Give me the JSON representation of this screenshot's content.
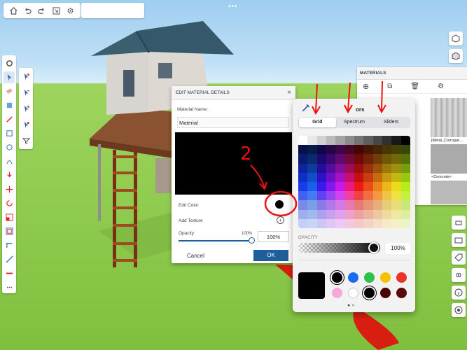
{
  "toolbar": {
    "buttons": [
      "home-icon",
      "undo-icon",
      "redo-icon",
      "export-icon",
      "settings-icon"
    ],
    "more": "•••"
  },
  "materials_panel": {
    "title": "MATERIALS",
    "items": [
      "[Metal_Corrogat...",
      "<Concrete>"
    ]
  },
  "edit_dialog": {
    "title": "EDIT MATERIAL DETAILS",
    "name_label": "Material Name:",
    "name_value": "Material",
    "edit_color_label": "Edit Color",
    "add_texture_label": "Add Texture",
    "opacity_label": "Opacity",
    "opacity_percent": "100%",
    "opacity_value": "100%",
    "opacity_level": 1.0,
    "cancel_label": "Cancel",
    "ok_label": "OK"
  },
  "color_picker": {
    "title_partial": "ors",
    "tabs": [
      "Grid",
      "Spectrum",
      "Sliders"
    ],
    "selected_tab": "Grid",
    "opacity_label": "OPACITY",
    "opacity_value": "100%",
    "current_color": "#000000",
    "swatches_row1": [
      "#000000",
      "#1a6cf0",
      "#2bc24a",
      "#f6c100",
      "#e8322a"
    ],
    "swatches_row2": [
      "#f7a8d9",
      "#ffffff",
      "#000000",
      "#4a0000",
      "#5a0a0a"
    ]
  },
  "annotations": {
    "number": "2"
  }
}
